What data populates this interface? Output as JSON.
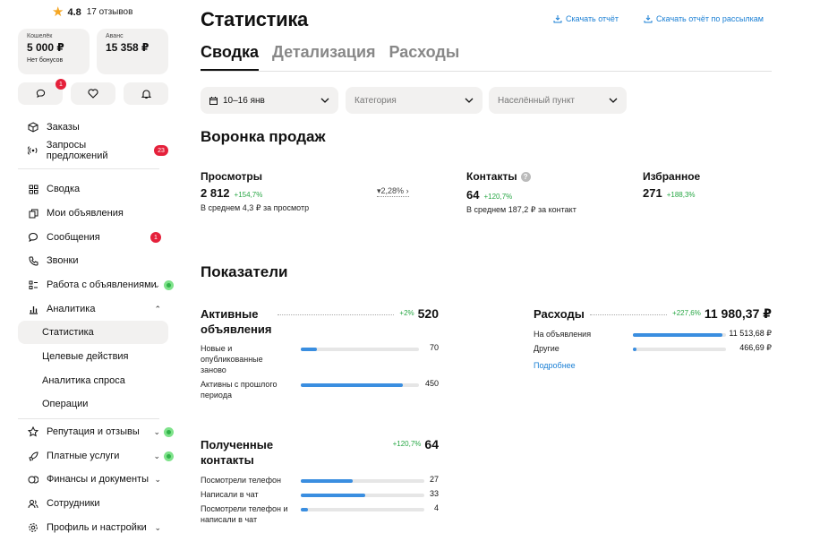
{
  "profile": {
    "rating": "4.8",
    "reviews": "17 отзывов"
  },
  "wallets": [
    {
      "label": "Кошелёк",
      "amount": "5 000 ₽",
      "note": "Нет бонусов"
    },
    {
      "label": "Аванс",
      "amount": "15 358 ₽",
      "note": ""
    }
  ],
  "icons": {
    "messages_badge": "1"
  },
  "sidebar": {
    "top": [
      {
        "label": "Заказы",
        "icon": "box-icon"
      },
      {
        "label": "Запросы предложений",
        "icon": "broadcast-icon",
        "badge": "23"
      }
    ],
    "items": [
      {
        "label": "Сводка",
        "icon": "grid-icon"
      },
      {
        "label": "Мои объявления",
        "icon": "copy-icon"
      },
      {
        "label": "Сообщения",
        "icon": "chat-icon",
        "badge": "1"
      },
      {
        "label": "Звонки",
        "icon": "phone-icon"
      },
      {
        "label": "Работа с объявлениями",
        "icon": "list-icon",
        "chevron": "down",
        "dot": true
      },
      {
        "label": "Аналитика",
        "icon": "chart-icon",
        "chevron": "up"
      },
      {
        "label": "Статистика",
        "sub": true,
        "active": true
      },
      {
        "label": "Целевые действия",
        "sub": true
      },
      {
        "label": "Аналитика спроса",
        "sub": true
      },
      {
        "label": "Операции",
        "sub": true
      },
      {
        "label": "Репутация и отзывы",
        "icon": "star-outline-icon",
        "chevron": "down",
        "dot": true
      },
      {
        "label": "Платные услуги",
        "icon": "rocket-icon",
        "chevron": "down",
        "dot": true
      },
      {
        "label": "Финансы и документы",
        "icon": "coins-icon",
        "chevron": "down"
      },
      {
        "label": "Сотрудники",
        "icon": "users-icon"
      },
      {
        "label": "Профиль и настройки",
        "icon": "gear-icon",
        "chevron": "down"
      }
    ]
  },
  "header": {
    "title": "Статистика",
    "download_report": "Скачать отчёт",
    "download_mailing": "Скачать отчёт по рассылкам"
  },
  "tabs": [
    "Сводка",
    "Детализация",
    "Расходы"
  ],
  "filters": {
    "date": "10–16 янв",
    "category": "Категория",
    "city": "Населённый пункт"
  },
  "funnel": {
    "title": "Воронка продаж",
    "views": {
      "label": "Просмотры",
      "value": "2 812",
      "delta": "+154,7%",
      "sub": "В среднем 4,3 ₽ за просмотр"
    },
    "conversion": "2,28%",
    "contacts": {
      "label": "Контакты",
      "value": "64",
      "delta": "+120,7%",
      "sub": "В среднем 187,2 ₽ за контакт"
    },
    "favorites": {
      "label": "Избранное",
      "value": "271",
      "delta": "+188,3%"
    }
  },
  "indicators": {
    "title": "Показатели",
    "active": {
      "title": "Активные объявления",
      "delta": "+2%",
      "value": "520",
      "rows": [
        {
          "label": "Новые и опубликованные заново",
          "value": "70",
          "fill": 0.135
        },
        {
          "label": "Активны с прошлого периода",
          "value": "450",
          "fill": 0.865
        }
      ]
    },
    "expenses": {
      "title": "Расходы",
      "delta": "+227,6%",
      "value": "11 980,37 ₽",
      "rows": [
        {
          "label": "На объявления",
          "value": "11 513,68 ₽",
          "fill": 0.96
        },
        {
          "label": "Другие",
          "value": "466,69 ₽",
          "fill": 0.04
        }
      ],
      "more": "Подробнее"
    },
    "contacts": {
      "title": "Полученные контакты",
      "delta": "+120,7%",
      "value": "64",
      "rows": [
        {
          "label": "Посмотрели телефон",
          "value": "27",
          "fill": 0.42
        },
        {
          "label": "Написали в чат",
          "value": "33",
          "fill": 0.52
        },
        {
          "label": "Посмотрели телефон и написали в чат",
          "value": "4",
          "fill": 0.06
        }
      ]
    }
  }
}
